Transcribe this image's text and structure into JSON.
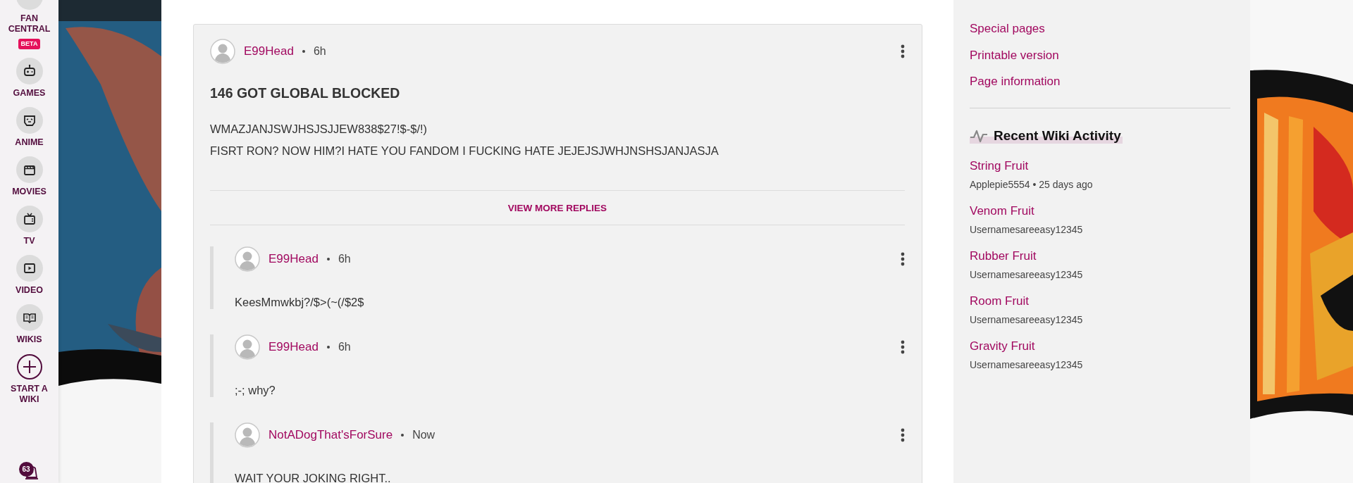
{
  "nav": {
    "items": [
      {
        "kind": "fan",
        "label": "FAN CENTRAL",
        "badge": "BETA"
      },
      {
        "kind": "games",
        "label": "GAMES"
      },
      {
        "kind": "anime",
        "label": "ANIME"
      },
      {
        "kind": "movies",
        "label": "MOVIES"
      },
      {
        "kind": "tv",
        "label": "TV"
      },
      {
        "kind": "video",
        "label": "VIDEO"
      },
      {
        "kind": "wikis",
        "label": "WIKIS"
      },
      {
        "kind": "start",
        "label": "START A WIKI"
      }
    ],
    "notifications": {
      "count": "63"
    }
  },
  "comment": {
    "author": "E99Head",
    "time": "6h",
    "title": "146 GOT GLOBAL BLOCKED",
    "lines": [
      "WMAZJANJSWJHSJSJJEW838$27!$-$/!)",
      "FISRT RON? NOW HIM?I HATE YOU FANDOM I FUCKING HATE JEJEJSJWHJNSHSJANJASJA"
    ],
    "view_more": "VIEW MORE REPLIES",
    "replies": [
      {
        "author": "E99Head",
        "time": "6h",
        "text": "KeesMmwkbj?/$>(~(/$2$"
      },
      {
        "author": "E99Head",
        "time": "6h",
        "text": ";-; why?"
      },
      {
        "author": "NotADogThat'sForSure",
        "time": "Now",
        "text": "WAIT YOUR JOKING RIGHT.."
      }
    ]
  },
  "rail": {
    "tools": [
      "Special pages",
      "Printable version",
      "Page information"
    ],
    "activity": {
      "title": "Recent Wiki Activity",
      "items": [
        {
          "page": "String Fruit",
          "meta": "Applepie5554 • 25 days ago"
        },
        {
          "page": "Venom Fruit",
          "meta": "Usernamesareeasy12345"
        },
        {
          "page": "Rubber Fruit",
          "meta": "Usernamesareeasy12345"
        },
        {
          "page": "Room Fruit",
          "meta": "Usernamesareeasy12345"
        },
        {
          "page": "Gravity Fruit",
          "meta": "Usernamesareeasy12345"
        }
      ]
    }
  }
}
